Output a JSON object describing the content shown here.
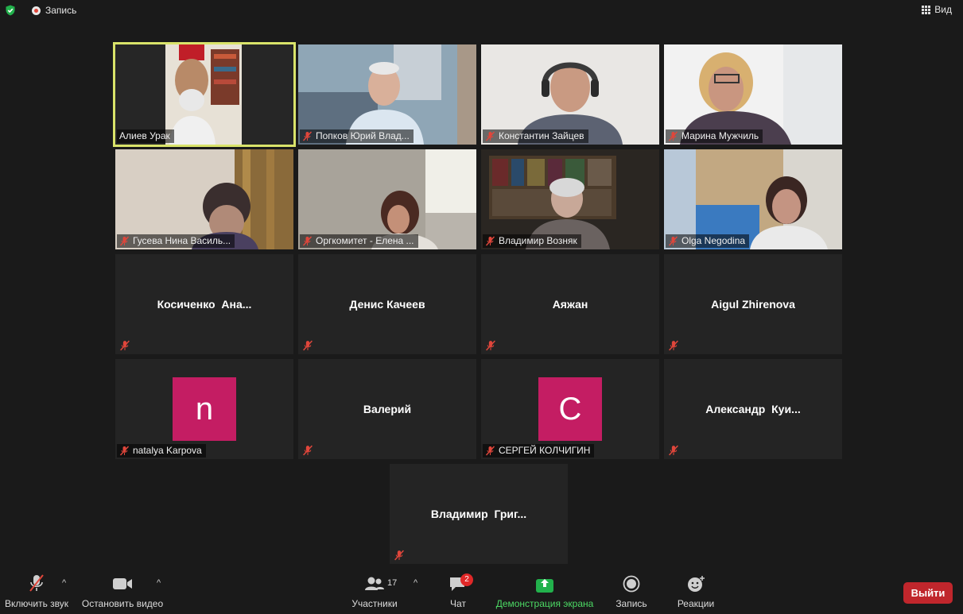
{
  "topbar": {
    "recording_label": "Запись",
    "view_label": "Вид"
  },
  "video_tiles": [
    {
      "name": "Алиев Урак",
      "muted": false,
      "active": true
    },
    {
      "name": "Попков Юрий Влад...",
      "muted": true
    },
    {
      "name": "Константин Зайцев",
      "muted": true
    },
    {
      "name": "Марина Мужчиль",
      "muted": true
    },
    {
      "name": "Гусева Нина Василь...",
      "muted": true
    },
    {
      "name": "Оргкомитет - Елена ...",
      "muted": true
    },
    {
      "name": "Владимир Возняк",
      "muted": true
    },
    {
      "name": "Olga Negodina",
      "muted": true
    }
  ],
  "name_tiles": [
    {
      "display": "Косиченко  Ана...",
      "muted": true
    },
    {
      "display": "Денис Качеев",
      "muted": true
    },
    {
      "display": "Аяжан",
      "muted": true
    },
    {
      "display": "Aigul Zhirenova",
      "muted": true
    },
    {
      "avatar_letter": "n",
      "name": "natalya Karpova",
      "muted": true
    },
    {
      "display": "Валерий",
      "muted": true
    },
    {
      "avatar_letter": "C",
      "name": "СЕРГЕЙ КОЛЧИГИН",
      "muted": true
    },
    {
      "display": "Александр  Куи...",
      "muted": true
    },
    {
      "display": "Владимир  Григ...",
      "muted": true
    }
  ],
  "toolbar": {
    "unmute_label": "Включить звук",
    "stop_video_label": "Остановить видео",
    "participants_label": "Участники",
    "participants_count": "17",
    "chat_label": "Чат",
    "chat_badge": "2",
    "share_label": "Демонстрация экрана",
    "record_label": "Запись",
    "reactions_label": "Реакции",
    "leave_label": "Выйти"
  },
  "colors": {
    "active_speaker_border": "#d9e36a",
    "share_green": "#22b14c",
    "share_text": "#4cd964",
    "leave_red": "#c0262c",
    "avatar_pink": "#c41d63",
    "mute_red": "#e0463b"
  }
}
